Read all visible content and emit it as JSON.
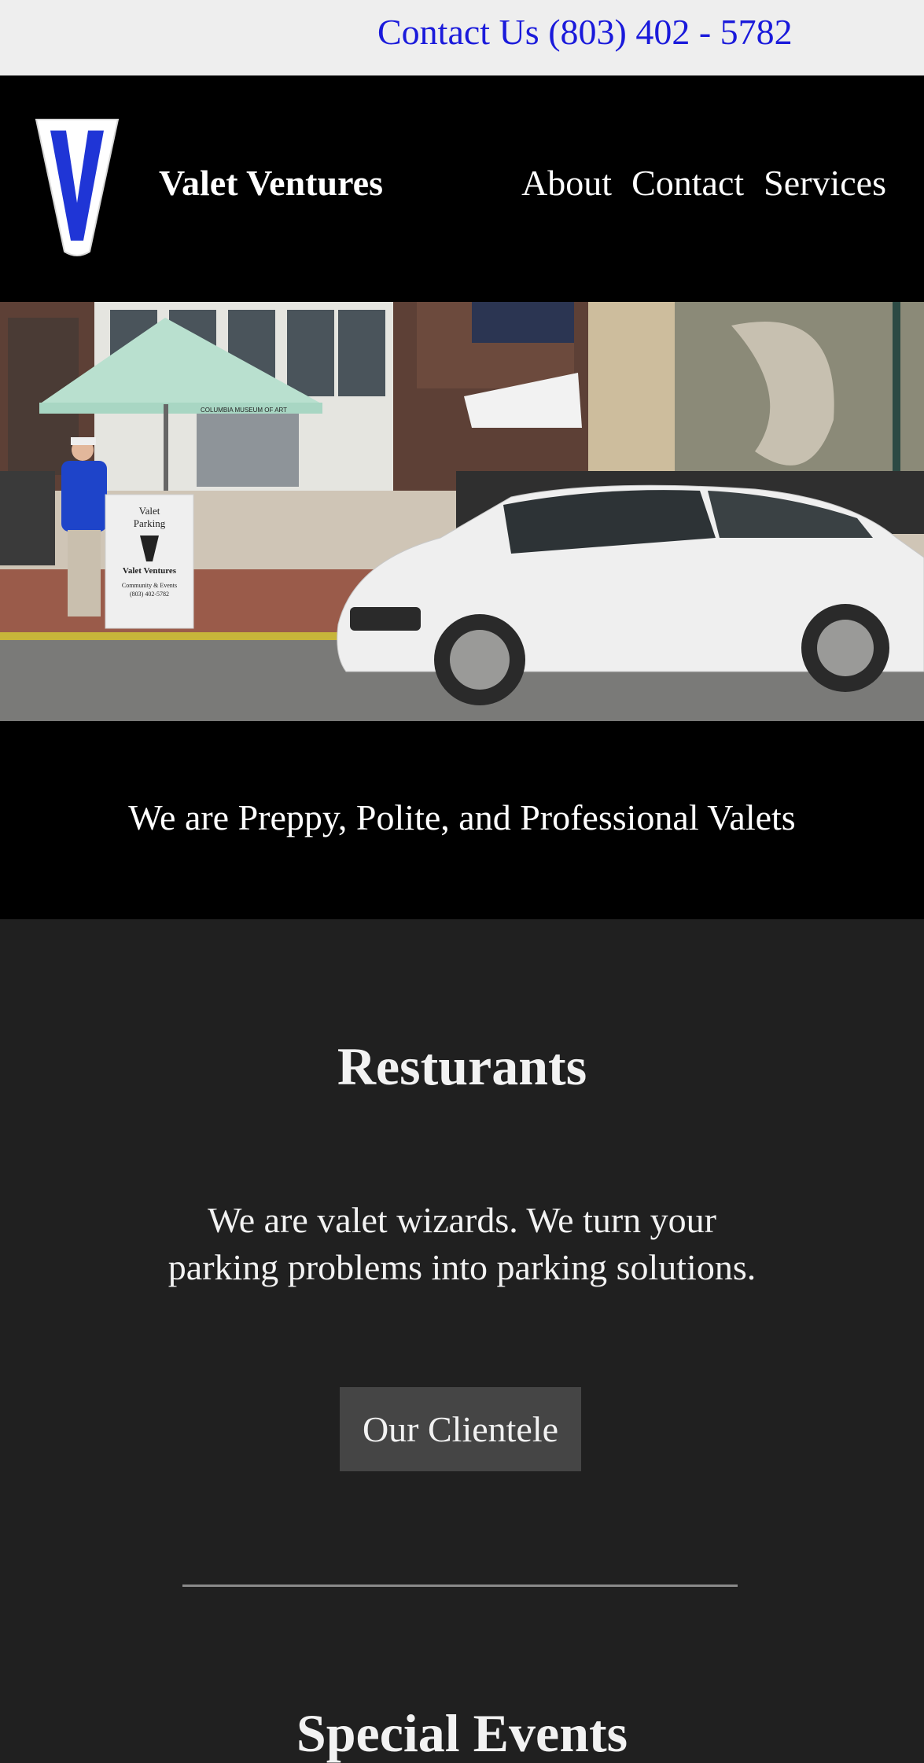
{
  "topbar": {
    "contact": "Contact Us (803) 402 - 5782"
  },
  "header": {
    "logo_icon": "valet-ventures-v-logo",
    "brand": "Valet Ventures",
    "nav": [
      "About",
      "Contact",
      "Services"
    ]
  },
  "hero": {
    "sign_line1": "Valet",
    "sign_line2": "Parking",
    "sign_brand": "Valet Ventures",
    "sign_caption": "Community & Events",
    "sign_phone": "(803) 402-5782",
    "building_sign": "COLUMBIA MUSEUM OF ART"
  },
  "tagline": "We are Preppy, Polite, and Professional Valets",
  "restaurants": {
    "title": "Resturants",
    "text_line1": "We are valet wizards. We turn your",
    "text_line2": "parking problems into parking solutions.",
    "button": "Our Clientele"
  },
  "special_events": {
    "title": "Special Events"
  },
  "colors": {
    "contact_link": "#1a1adb",
    "logo_blue": "#1f35d6",
    "page_bg": "#202020",
    "button_bg": "#454545"
  }
}
